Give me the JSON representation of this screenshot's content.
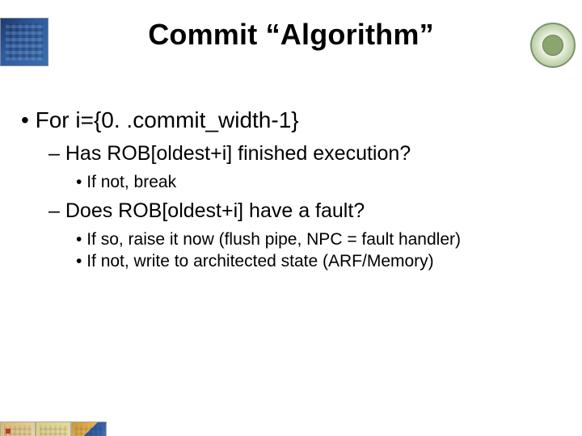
{
  "title": "Commit “Algorithm”",
  "bullets": {
    "l1": "For i={0. .commit_width-1}",
    "l2a": "Has ROB[oldest+i] finished execution?",
    "l3a": "If not, break",
    "l2b": "Does ROB[oldest+i] have a fault?",
    "l3b": "If so, raise it now (flush pipe, NPC = fault handler)",
    "l3c": "If not, write to architected state (ARF/Memory)"
  }
}
